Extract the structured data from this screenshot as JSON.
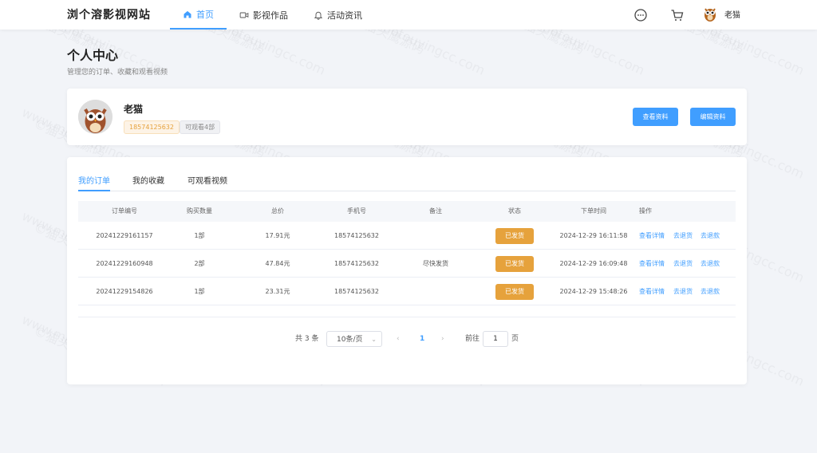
{
  "header": {
    "logo": "浏个溶影视网站",
    "nav": [
      {
        "label": "首页",
        "icon": "home-icon",
        "active": true
      },
      {
        "label": "影视作品",
        "icon": "video-icon",
        "active": false
      },
      {
        "label": "活动资讯",
        "icon": "bell-icon",
        "active": false
      }
    ],
    "user_name": "老猫"
  },
  "page": {
    "title": "个人中心",
    "subtitle": "管理您的订单、收藏和观看视频"
  },
  "profile": {
    "name": "老猫",
    "phone_tag": "18574125632",
    "count_tag": "可观看4部",
    "view_button": "查看资料",
    "edit_button": "编辑资料"
  },
  "tabs": [
    "我的订单",
    "我的收藏",
    "可观看视频"
  ],
  "table": {
    "headers": [
      "订单编号",
      "购买数量",
      "总价",
      "手机号",
      "备注",
      "状态",
      "下单时间",
      "操作"
    ],
    "rows": [
      {
        "id": "20241229161157",
        "qty": "1部",
        "total": "17.91元",
        "phone": "18574125632",
        "note": "",
        "status": "已发货",
        "time": "2024-12-29 16:11:58"
      },
      {
        "id": "20241229160948",
        "qty": "2部",
        "total": "47.84元",
        "phone": "18574125632",
        "note": "尽快发货",
        "status": "已发货",
        "time": "2024-12-29 16:09:48"
      },
      {
        "id": "20241229154826",
        "qty": "1部",
        "total": "23.31元",
        "phone": "18574125632",
        "note": "",
        "status": "已发货",
        "time": "2024-12-29 15:48:26"
      }
    ],
    "actions": [
      "查看详情",
      "去退货",
      "去退款"
    ]
  },
  "pagination": {
    "total": "共 3 条",
    "page_size": "10条/页",
    "current": "1",
    "goto_label": "前往",
    "goto_value": "1",
    "goto_suffix": "页"
  },
  "watermark": {
    "line1": "©猫头鹰源码",
    "line2": "www.maotouyingcc.com"
  },
  "colors": {
    "accent": "#409eff",
    "status": "#e6a23c"
  }
}
